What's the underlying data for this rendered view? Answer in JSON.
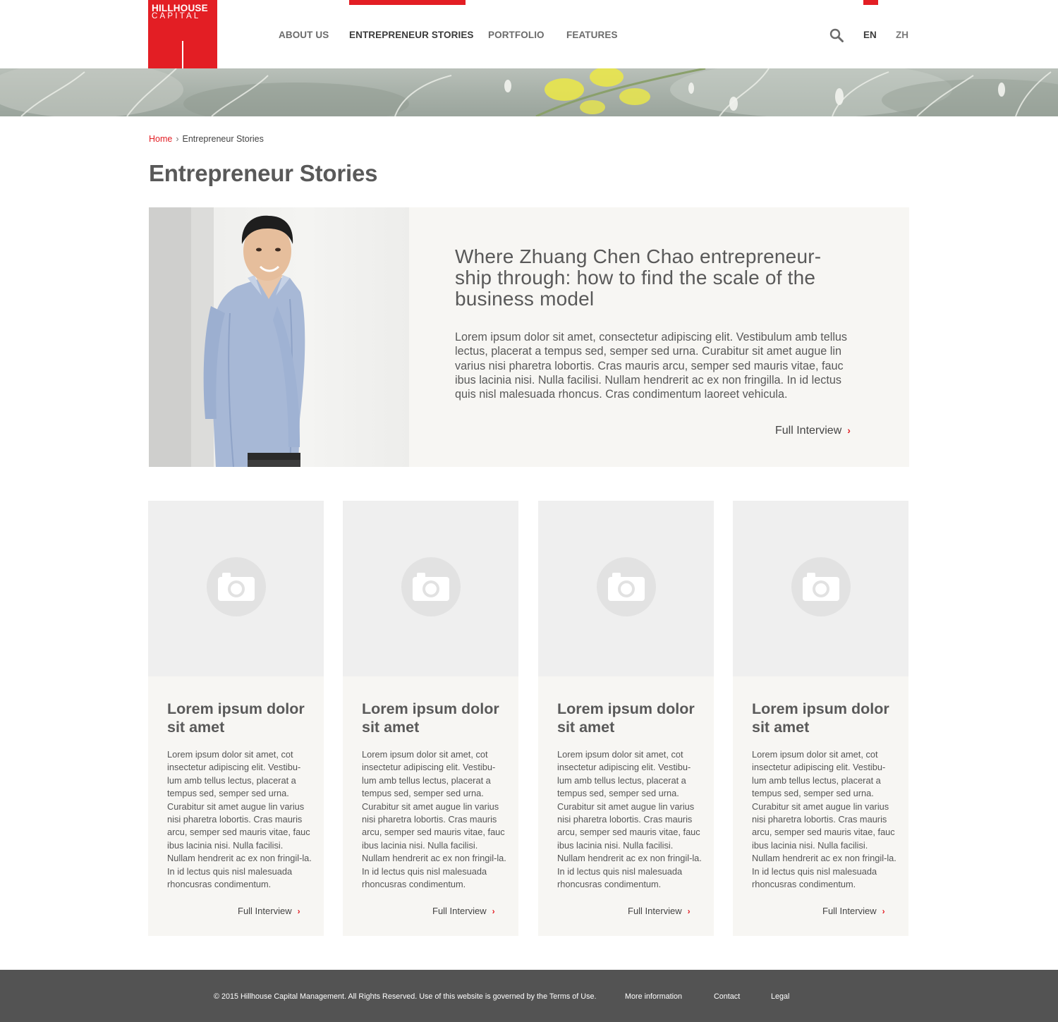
{
  "brand": {
    "line1": "HILLHOUSE",
    "line2": "CAPITAL",
    "accent": "#e31e24"
  },
  "nav": {
    "items": [
      {
        "label": "ABOUT US"
      },
      {
        "label": "ENTREPRENEUR STORIES",
        "active": true
      },
      {
        "label": "PORTFOLIO"
      },
      {
        "label": "FEATURES"
      }
    ],
    "search_icon": "search-icon",
    "languages": [
      {
        "label": "EN",
        "active": true
      },
      {
        "label": "ZH"
      }
    ]
  },
  "breadcrumb": {
    "home": "Home",
    "separator": "›",
    "current": "Entrepreneur Stories"
  },
  "page_title": "Entrepreneur Stories",
  "featured": {
    "title": "Where Zhuang Chen Chao entrepreneur-ship through: how to find the scale of the business model",
    "body": "Lorem ipsum dolor sit amet, consectetur adipiscing elit. Vestibulum amb tellus lectus, placerat a tempus sed, semper sed urna. Curabitur sit amet augue lin varius nisi pharetra lobortis. Cras mauris arcu, semper sed mauris vitae, fauc ibus lacinia nisi. Nulla facilisi. Nullam hendrerit ac ex non fringilla. In id lectus quis nisl malesuada rhoncus. Cras condimentum laoreet vehicula.",
    "link": "Full Interview",
    "chevron": "›"
  },
  "cards": [
    {
      "title": "Lorem ipsum dolor sit amet",
      "body": "Lorem ipsum dolor sit amet, cot insectetur adipiscing elit. Vestibu-lum amb tellus lectus, placerat a tempus sed, semper sed urna. Curabitur sit amet augue lin varius nisi pharetra lobortis. Cras mauris arcu, semper sed mauris vitae, fauc ibus lacinia nisi. Nulla facilisi. Nullam hendrerit ac ex non fringil-la. In id lectus quis nisl malesuada rhoncusras condimentum.",
      "link": "Full Interview",
      "icon": "camera-icon"
    },
    {
      "title": "Lorem ipsum dolor sit amet",
      "body": "Lorem ipsum dolor sit amet, cot insectetur adipiscing elit. Vestibu-lum amb tellus lectus, placerat a tempus sed, semper sed urna. Curabitur sit amet augue lin varius nisi pharetra lobortis. Cras mauris arcu, semper sed mauris vitae, fauc ibus lacinia nisi. Nulla facilisi. Nullam hendrerit ac ex non fringil-la. In id lectus quis nisl malesuada rhoncusras condimentum.",
      "link": "Full Interview",
      "icon": "camera-icon"
    },
    {
      "title": "Lorem ipsum dolor sit amet",
      "body": "Lorem ipsum dolor sit amet, cot insectetur adipiscing elit. Vestibu-lum amb tellus lectus, placerat a tempus sed, semper sed urna. Curabitur sit amet augue lin varius nisi pharetra lobortis. Cras mauris arcu, semper sed mauris vitae, fauc ibus lacinia nisi. Nulla facilisi. Nullam hendrerit ac ex non fringil-la. In id lectus quis nisl malesuada rhoncusras condimentum.",
      "link": "Full Interview",
      "icon": "camera-icon"
    },
    {
      "title": "Lorem ipsum dolor sit amet",
      "body": "Lorem ipsum dolor sit amet, cot insectetur adipiscing elit. Vestibu-lum amb tellus lectus, placerat a tempus sed, semper sed urna. Curabitur sit amet augue lin varius nisi pharetra lobortis. Cras mauris arcu, semper sed mauris vitae, fauc ibus lacinia nisi. Nulla facilisi. Nullam hendrerit ac ex non fringil-la. In id lectus quis nisl malesuada rhoncusras condimentum.",
      "link": "Full Interview",
      "icon": "camera-icon"
    }
  ],
  "footer": {
    "copyright": "© 2015 Hillhouse Capital Management. All Rights Reserved. Use of this website is governed by the Terms of Use.",
    "links": [
      "More information",
      "Contact",
      "Legal"
    ],
    "background": "#535353"
  }
}
